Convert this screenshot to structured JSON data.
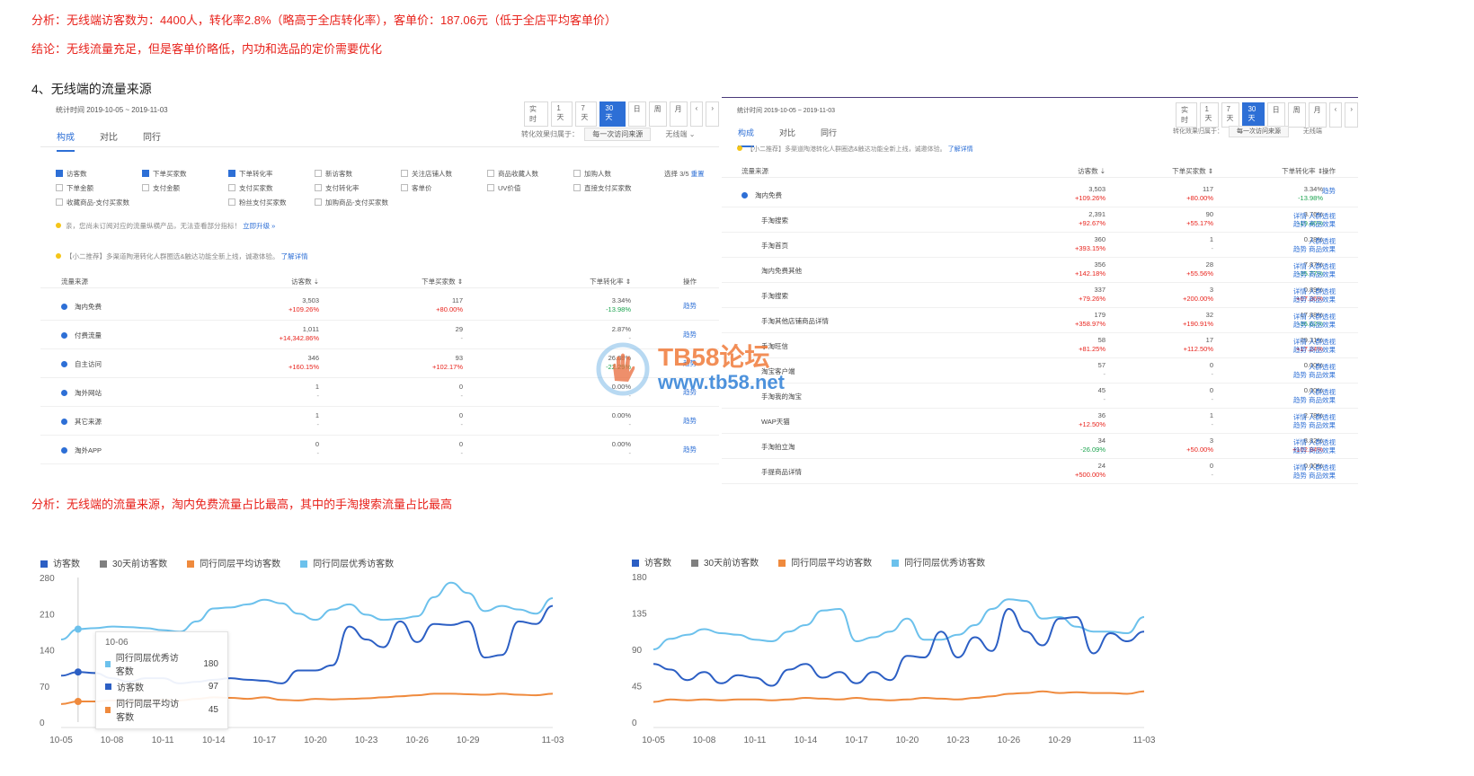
{
  "texts": {
    "analysis1": "分析：无线端访客数为：4400人，转化率2.8%（略高于全店转化率），客单价：187.06元（低于全店平均客单价）",
    "conclusion": "结论：无线流量充足，但是客单价略低，内功和选品的定价需要优化",
    "heading": "4、无线端的流量来源",
    "analysis2": "分析：无线端的流量来源，淘内免费流量占比最高，其中的手淘搜索流量占比最高"
  },
  "left_panel": {
    "stat_time": "统计时间 2019-10-05 ~ 2019-11-03",
    "range_buttons": [
      "实时",
      "1天",
      "7天",
      "30天",
      "日",
      "周",
      "月",
      "‹",
      "›"
    ],
    "active_range": "30天",
    "tabs": [
      "构成",
      "对比",
      "同行"
    ],
    "conv_label": "转化效果归属于：",
    "conv_value": "每一次访问来源",
    "device": "无线端",
    "metrics": [
      {
        "label": "访客数",
        "checked": true
      },
      {
        "label": "下单买家数",
        "checked": true
      },
      {
        "label": "下单转化率",
        "checked": true
      },
      {
        "label": "新访客数",
        "checked": false
      },
      {
        "label": "关注店铺人数",
        "checked": false
      },
      {
        "label": "商品收藏人数",
        "checked": false
      },
      {
        "label": "加购人数",
        "checked": false
      },
      {
        "label": "下单金额",
        "checked": false
      },
      {
        "label": "支付金额",
        "checked": false
      },
      {
        "label": "支付买家数",
        "checked": false
      },
      {
        "label": "支付转化率",
        "checked": false
      },
      {
        "label": "客单价",
        "checked": false
      },
      {
        "label": "UV价值",
        "checked": false
      },
      {
        "label": "直接支付买家数",
        "checked": false
      },
      {
        "label": "收藏商品-支付买家数",
        "checked": false
      },
      {
        "label": "",
        "checked": false
      },
      {
        "label": "粉丝支付买家数",
        "checked": false
      },
      {
        "label": "加购商品-支付买家数",
        "checked": false
      }
    ],
    "select_count": "选择 3/5",
    "reset": "重置",
    "notice1": "亲，您尚未订阅对应的流量纵横产品，无法查看部分指标！",
    "notice1_link": "立即升级 »",
    "notice2": "【小二推荐】多渠道陶港转化人群圈选&触达功能全新上线，诚邀体验。",
    "notice2_link": "了解详情",
    "columns": [
      "流量来源",
      "访客数 ⇣",
      "下单买家数 ⇕",
      "下单转化率 ⇕",
      "操作"
    ],
    "rows": [
      {
        "name": "淘内免费",
        "visitors": "3,503",
        "v_chg": "+109.26%",
        "buyers": "117",
        "b_chg": "+80.00%",
        "rate": "3.34%",
        "r_chg": "-13.98%",
        "op": "趋势"
      },
      {
        "name": "付费流量",
        "visitors": "1,011",
        "v_chg": "+14,342.86%",
        "buyers": "29",
        "b_chg": "-",
        "rate": "2.87%",
        "r_chg": "-",
        "op": "趋势"
      },
      {
        "name": "自主访问",
        "visitors": "346",
        "v_chg": "+160.15%",
        "buyers": "93",
        "b_chg": "+102.17%",
        "rate": "26.88%",
        "r_chg": "-22.29%",
        "op": "趋势"
      },
      {
        "name": "淘外网站",
        "visitors": "1",
        "v_chg": "-",
        "buyers": "0",
        "b_chg": "-",
        "rate": "0.00%",
        "r_chg": "-",
        "op": "趋势"
      },
      {
        "name": "其它来源",
        "visitors": "1",
        "v_chg": "-",
        "buyers": "0",
        "b_chg": "-",
        "rate": "0.00%",
        "r_chg": "-",
        "op": "趋势"
      },
      {
        "name": "淘外APP",
        "visitors": "0",
        "v_chg": "-",
        "buyers": "0",
        "b_chg": "-",
        "rate": "0.00%",
        "r_chg": "-",
        "op": "趋势"
      }
    ]
  },
  "right_panel": {
    "stat_time": "统计时间 2019-10-05 ~ 2019-11-03",
    "range_buttons": [
      "实时",
      "1天",
      "7天",
      "30天",
      "日",
      "周",
      "月",
      "‹",
      "›"
    ],
    "active_range": "30天",
    "tabs": [
      "构成",
      "对比",
      "同行"
    ],
    "conv_label": "转化效果归属于：",
    "conv_value": "每一次访问来源",
    "device": "无线端",
    "notice": "【小二推荐】多渠道陶港转化人群圈选&触达功能全新上线，诚邀体验。",
    "notice_link": "了解详情",
    "columns": [
      "流量来源",
      "访客数 ⇣",
      "下单买家数 ⇕",
      "下单转化率 ⇕",
      "操作"
    ],
    "rows": [
      {
        "name": "淘内免费",
        "visitors": "3,503",
        "v_chg": "+109.26%",
        "buyers": "117",
        "b_chg": "+80.00%",
        "rate": "3.34%",
        "r_chg": "-13.98%",
        "op1": "趋势",
        "op2": ""
      },
      {
        "name": "手淘搜索",
        "visitors": "2,391",
        "v_chg": "+92.67%",
        "buyers": "90",
        "b_chg": "+55.17%",
        "rate": "3.76%",
        "r_chg": "-19.46%",
        "op1": "详情 人群透视",
        "op2": "趋势 商品效果"
      },
      {
        "name": "手淘首页",
        "visitors": "360",
        "v_chg": "+393.15%",
        "buyers": "1",
        "b_chg": "-",
        "rate": "0.28%",
        "r_chg": "-",
        "op1": "人群透视",
        "op2": "趋势 商品效果"
      },
      {
        "name": "淘内免费其他",
        "visitors": "356",
        "v_chg": "+142.18%",
        "buyers": "28",
        "b_chg": "+55.56%",
        "rate": "7.87%",
        "r_chg": "-35.77%",
        "op1": "详情 人群透视",
        "op2": "趋势 商品效果"
      },
      {
        "name": "手淘搜索",
        "visitors": "337",
        "v_chg": "+79.26%",
        "buyers": "3",
        "b_chg": "+200.00%",
        "rate": "0.89%",
        "r_chg": "+67.36%",
        "op1": "详情 人群透视",
        "op2": "趋势 商品效果"
      },
      {
        "name": "手淘其他店铺商品详情",
        "visitors": "179",
        "v_chg": "+358.97%",
        "buyers": "32",
        "b_chg": "+190.91%",
        "rate": "17.88%",
        "r_chg": "-36.62%",
        "op1": "详情 人群透视",
        "op2": "趋势 商品效果"
      },
      {
        "name": "手淘旺信",
        "visitors": "58",
        "v_chg": "+81.25%",
        "buyers": "17",
        "b_chg": "+112.50%",
        "rate": "29.31%",
        "r_chg": "+17.24%",
        "op1": "详情 人群透视",
        "op2": "趋势 商品效果"
      },
      {
        "name": "淘宝客户端",
        "visitors": "57",
        "v_chg": "-",
        "buyers": "0",
        "b_chg": "-",
        "rate": "0.00%",
        "r_chg": "-",
        "op1": "人群透视",
        "op2": "趋势 商品效果"
      },
      {
        "name": "手淘我的淘宝",
        "visitors": "45",
        "v_chg": "-",
        "buyers": "0",
        "b_chg": "-",
        "rate": "0.00%",
        "r_chg": "-",
        "op1": "人群透视",
        "op2": "趋势 商品效果"
      },
      {
        "name": "WAP天猫",
        "visitors": "36",
        "v_chg": "+12.50%",
        "buyers": "1",
        "b_chg": "-",
        "rate": "2.78%",
        "r_chg": "-",
        "op1": "详情 人群透视",
        "op2": "趋势 商品效果"
      },
      {
        "name": "手淘拍立淘",
        "visitors": "34",
        "v_chg": "-26.09%",
        "buyers": "3",
        "b_chg": "+50.00%",
        "rate": "8.82%",
        "r_chg": "+102.94%",
        "op1": "详情 人群透视",
        "op2": "趋势 商品效果"
      },
      {
        "name": "手提商品详情",
        "visitors": "24",
        "v_chg": "+500.00%",
        "buyers": "0",
        "b_chg": "-",
        "rate": "0.00%",
        "r_chg": "-",
        "op1": "详情 人群透视",
        "op2": "趋势 商品效果"
      }
    ]
  },
  "watermark": {
    "line1": "TB58论坛",
    "line2": "www.tb58.net"
  },
  "colors": {
    "visitors": "#2c5fc4",
    "prev30": "#7f7f7f",
    "peer_avg": "#ef8a3d",
    "peer_best": "#6cc1ec",
    "accent": "#2d6fd6",
    "red": "#e8231c"
  },
  "chart_data": [
    {
      "type": "line",
      "legend": [
        "访客数",
        "30天前访客数",
        "同行同层平均访客数",
        "同行同层优秀访客数"
      ],
      "x": [
        "10-05",
        "10-06",
        "10-07",
        "10-08",
        "10-09",
        "10-10",
        "10-11",
        "10-12",
        "10-13",
        "10-14",
        "10-15",
        "10-16",
        "10-17",
        "10-18",
        "10-19",
        "10-20",
        "10-21",
        "10-22",
        "10-23",
        "10-24",
        "10-25",
        "10-26",
        "10-27",
        "10-28",
        "10-29",
        "10-30",
        "10-31",
        "11-01",
        "11-02",
        "11-03"
      ],
      "xticks": [
        "10-05",
        "10-08",
        "10-11",
        "10-14",
        "10-17",
        "10-20",
        "10-23",
        "10-26",
        "10-29",
        "11-03"
      ],
      "ylim": [
        0,
        280
      ],
      "yticks": [
        0,
        70,
        140,
        210,
        280
      ],
      "series": [
        {
          "name": "同行同层优秀访客数",
          "values": [
            160,
            180,
            182,
            185,
            184,
            182,
            178,
            175,
            195,
            220,
            222,
            228,
            237,
            230,
            210,
            198,
            218,
            228,
            208,
            198,
            200,
            205,
            242,
            270,
            250,
            215,
            225,
            218,
            210,
            240
          ]
        },
        {
          "name": "访客数",
          "values": [
            90,
            97,
            95,
            85,
            78,
            85,
            85,
            75,
            78,
            82,
            85,
            82,
            80,
            75,
            100,
            100,
            110,
            185,
            160,
            145,
            195,
            155,
            190,
            188,
            195,
            125,
            130,
            195,
            190,
            225
          ]
        },
        {
          "name": "同行同层平均访客数",
          "values": [
            35,
            40,
            40,
            42,
            40,
            42,
            43,
            42,
            45,
            48,
            47,
            45,
            48,
            43,
            42,
            45,
            44,
            45,
            46,
            48,
            50,
            52,
            55,
            55,
            54,
            53,
            55,
            53,
            52,
            55
          ]
        }
      ],
      "tooltip": {
        "date": "10-06",
        "items": [
          {
            "name": "同行同层优秀访客数",
            "value": "180"
          },
          {
            "name": "访客数",
            "value": "97"
          },
          {
            "name": "同行同层平均访客数",
            "value": "45"
          }
        ]
      }
    },
    {
      "type": "line",
      "legend": [
        "访客数",
        "30天前访客数",
        "同行同层平均访客数",
        "同行同层优秀访客数"
      ],
      "x": [
        "10-05",
        "10-06",
        "10-07",
        "10-08",
        "10-09",
        "10-10",
        "10-11",
        "10-12",
        "10-13",
        "10-14",
        "10-15",
        "10-16",
        "10-17",
        "10-18",
        "10-19",
        "10-20",
        "10-21",
        "10-22",
        "10-23",
        "10-24",
        "10-25",
        "10-26",
        "10-27",
        "10-28",
        "10-29",
        "10-30",
        "10-31",
        "11-01",
        "11-02",
        "11-03"
      ],
      "xticks": [
        "10-05",
        "10-08",
        "10-11",
        "10-14",
        "10-17",
        "10-20",
        "10-23",
        "10-26",
        "10-29",
        "11-03"
      ],
      "ylim": [
        0,
        180
      ],
      "yticks": [
        0,
        45,
        90,
        135,
        180
      ],
      "series": [
        {
          "name": "同行同层优秀访客数",
          "values": [
            90,
            103,
            108,
            115,
            110,
            108,
            102,
            100,
            112,
            120,
            138,
            140,
            100,
            105,
            112,
            128,
            102,
            102,
            108,
            120,
            140,
            152,
            150,
            128,
            130,
            118,
            112,
            112,
            110,
            130
          ]
        },
        {
          "name": "访客数",
          "values": [
            72,
            65,
            52,
            62,
            48,
            58,
            55,
            45,
            65,
            72,
            55,
            62,
            48,
            62,
            52,
            82,
            80,
            112,
            80,
            105,
            88,
            140,
            112,
            95,
            128,
            130,
            85,
            110,
            100,
            112
          ]
        },
        {
          "name": "同行同层平均访客数",
          "values": [
            25,
            28,
            27,
            28,
            27,
            28,
            28,
            27,
            28,
            30,
            29,
            28,
            30,
            28,
            27,
            28,
            30,
            29,
            28,
            30,
            32,
            35,
            36,
            38,
            36,
            37,
            36,
            36,
            35,
            38
          ]
        }
      ]
    }
  ]
}
